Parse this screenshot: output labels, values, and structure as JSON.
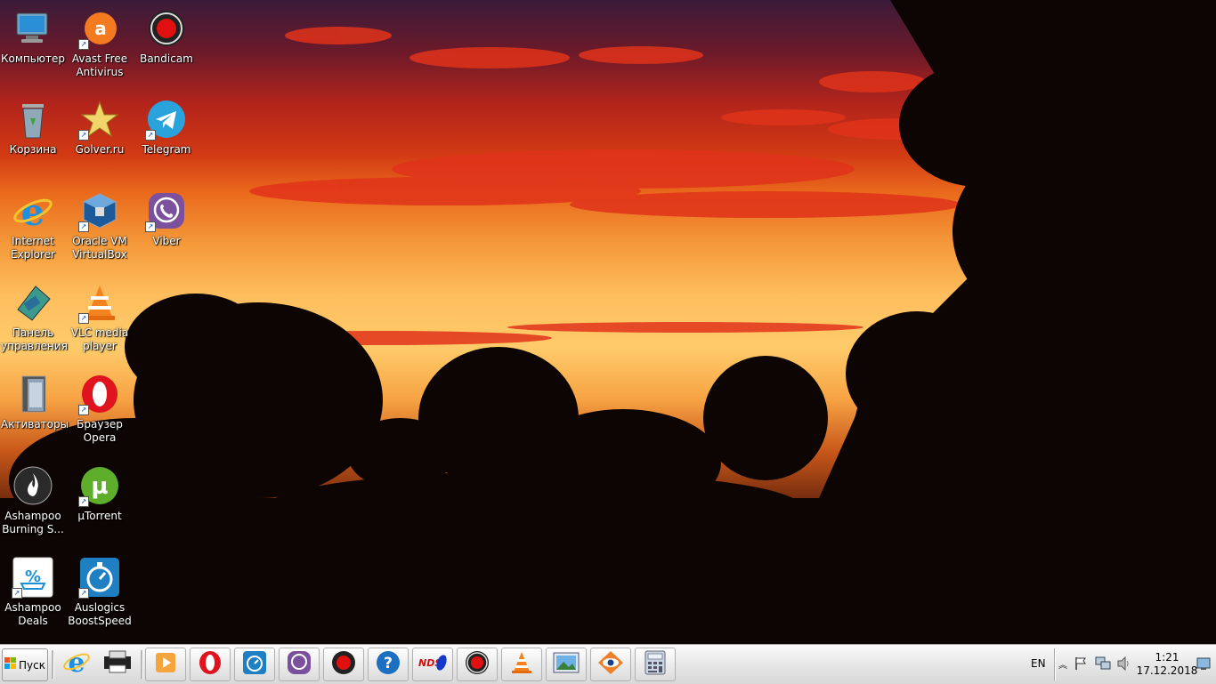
{
  "desktop": {
    "icons": [
      {
        "label": "Компьютер",
        "icon": "computer-icon",
        "shortcut": false
      },
      {
        "label": "Avast Free Antivirus",
        "icon": "avast-icon",
        "shortcut": true
      },
      {
        "label": "Bandicam",
        "icon": "bandicam-icon",
        "shortcut": false
      },
      {
        "label": "Корзина",
        "icon": "recycle-bin-icon",
        "shortcut": false
      },
      {
        "label": "Golver.ru",
        "icon": "star-icon",
        "shortcut": true
      },
      {
        "label": "Telegram",
        "icon": "telegram-icon",
        "shortcut": true
      },
      {
        "label": "Internet Explorer",
        "icon": "internet-explorer-icon",
        "shortcut": false
      },
      {
        "label": "Oracle VM VirtualBox",
        "icon": "virtualbox-icon",
        "shortcut": true
      },
      {
        "label": "Viber",
        "icon": "viber-icon",
        "shortcut": true
      },
      {
        "label": "Панель управления",
        "icon": "control-panel-icon",
        "shortcut": false
      },
      {
        "label": "VLC media player",
        "icon": "vlc-icon",
        "shortcut": true
      },
      {
        "label": "Активаторы",
        "icon": "folder-icon",
        "shortcut": false
      },
      {
        "label": "Браузер Opera",
        "icon": "opera-icon",
        "shortcut": true
      },
      {
        "label": "Ashampoo Burning S...",
        "icon": "ashampoo-burning-icon",
        "shortcut": false
      },
      {
        "label": "µTorrent",
        "icon": "utorrent-icon",
        "shortcut": true
      },
      {
        "label": "Ashampoo Deals",
        "icon": "ashampoo-deals-icon",
        "shortcut": true
      },
      {
        "label": "Auslogics BoostSpeed",
        "icon": "auslogics-icon",
        "shortcut": true
      }
    ]
  },
  "taskbar": {
    "start_label": "Пуск",
    "pinned": [
      "internet-explorer-icon",
      "printer-icon",
      "media-player-icon",
      "opera-icon",
      "auslogics-icon",
      "viber-icon",
      "bandicam-icon",
      "help-icon",
      "nds-icon",
      "record-icon",
      "vlc-icon",
      "picture-viewer-icon",
      "eye-icon",
      "calculator-icon"
    ],
    "language": "EN",
    "time": "1:21",
    "date": "17.12.2018"
  },
  "colors": {
    "taskbar_bg": "#e7e7e7",
    "icon_label": "#ffffff"
  }
}
